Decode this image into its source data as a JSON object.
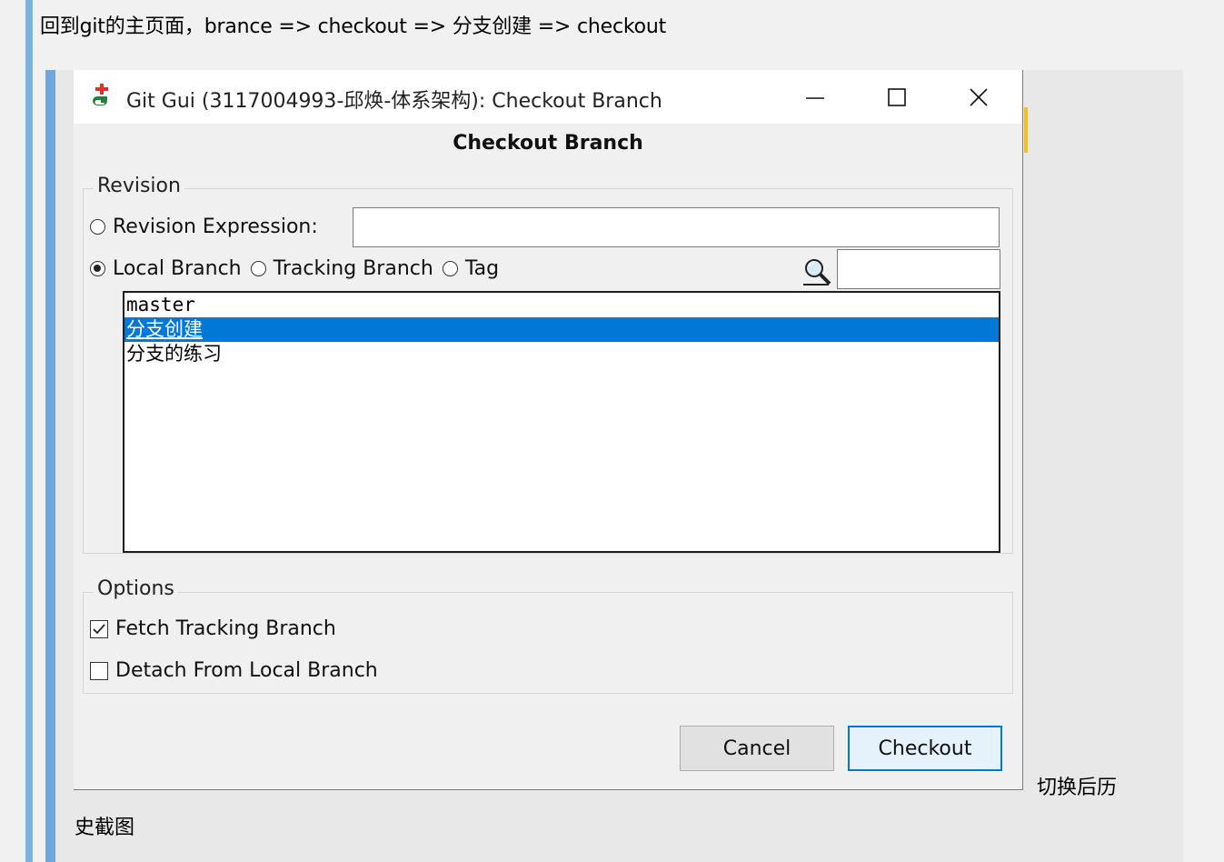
{
  "caption": "回到git的主页面，brance => checkout => 分支创建 => checkout",
  "window": {
    "title": "Git Gui (3117004993-邱焕-体系架构): Checkout Branch",
    "app_icon": "git-gui-icon",
    "controls": {
      "minimize": "minimize-icon",
      "maximize": "maximize-icon",
      "close": "close-icon"
    }
  },
  "dialog": {
    "heading": "Checkout Branch",
    "revision": {
      "legend": "Revision",
      "expression_label": "Revision Expression:",
      "expression_value": "",
      "local_branch_label": "Local Branch",
      "tracking_branch_label": "Tracking Branch",
      "tag_label": "Tag",
      "selected_source": "Local Branch",
      "filter_value": "",
      "filter_icon": "magnifier-icon",
      "branches": [
        "master",
        "分支创建",
        "分支的练习"
      ],
      "selected_branch": "分支创建"
    },
    "options": {
      "legend": "Options",
      "fetch_tracking_label": "Fetch Tracking Branch",
      "fetch_tracking_checked": true,
      "detach_label": "Detach From Local Branch",
      "detach_checked": false
    },
    "buttons": {
      "cancel": "Cancel",
      "checkout": "Checkout"
    }
  },
  "after_text_1": "切换后历",
  "after_text_2": "史截图"
}
